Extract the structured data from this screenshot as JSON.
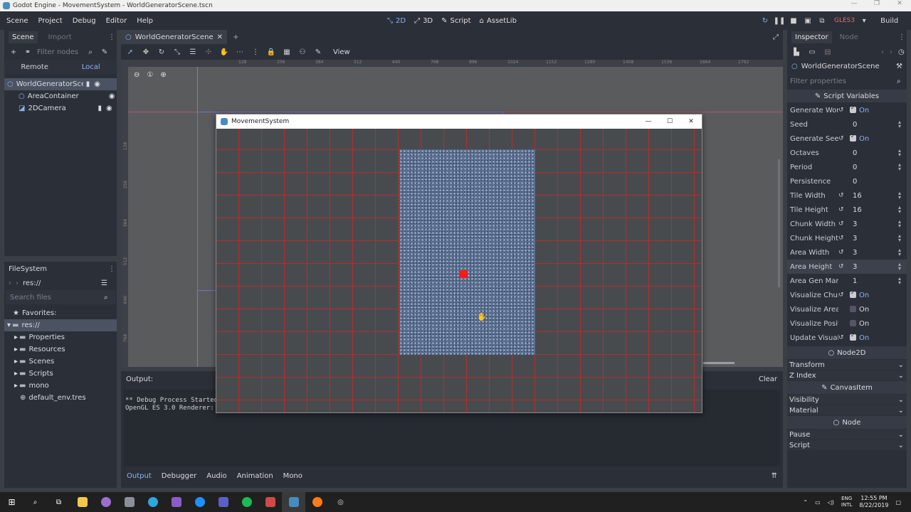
{
  "window": {
    "title": "Godot Engine - MovementSystem - WorldGeneratorScene.tscn"
  },
  "menu": [
    "Scene",
    "Project",
    "Debug",
    "Editor",
    "Help"
  ],
  "modes": {
    "d2": "2D",
    "d3": "3D",
    "script": "Script",
    "assetlib": "AssetLib"
  },
  "renderer": "GLES3",
  "build": "Build",
  "scene_dock": {
    "tabs": {
      "scene": "Scene",
      "import": "Import"
    },
    "filter_placeholder": "Filter nodes",
    "remote": "Remote",
    "local": "Local",
    "nodes": [
      {
        "label": "WorldGeneratorScen"
      },
      {
        "label": "AreaContainer"
      },
      {
        "label": "2DCamera"
      }
    ]
  },
  "filesystem": {
    "title": "FileSystem",
    "path": "res://",
    "search_placeholder": "Search files",
    "items": [
      {
        "label": "Favorites:"
      },
      {
        "label": "res://"
      },
      {
        "label": "Properties"
      },
      {
        "label": "Resources"
      },
      {
        "label": "Scenes"
      },
      {
        "label": "Scripts"
      },
      {
        "label": "mono"
      },
      {
        "label": "default_env.tres"
      }
    ]
  },
  "editor": {
    "tab": "WorldGeneratorScene",
    "view": "View",
    "ruler_labels": [
      "128",
      "256",
      "384",
      "512",
      "640",
      "768",
      "896",
      "1024",
      "1152",
      "1280",
      "1408",
      "1536",
      "1664",
      "1792"
    ],
    "vruler_labels": [
      "128",
      "256",
      "384",
      "512",
      "640",
      "768"
    ]
  },
  "game_window": {
    "title": "MovementSystem",
    "dot_color": "#ff1a1a",
    "grid_color": "#c82828"
  },
  "output": {
    "label": "Output:",
    "clear": "Clear",
    "lines": [
      "** Debug Process Started",
      "OpenGL ES 3.0 Renderer:"
    ],
    "tabs": [
      "Output",
      "Debugger",
      "Audio",
      "Animation",
      "Mono"
    ]
  },
  "inspector": {
    "tabs": {
      "inspector": "Inspector",
      "node": "Node"
    },
    "object": "WorldGeneratorScene",
    "filter_placeholder": "Filter properties",
    "section_script": "Script Variables",
    "props": [
      {
        "label": "Generate Worl",
        "value": "On",
        "kind": "check",
        "revert": true
      },
      {
        "label": "Seed",
        "value": "0",
        "kind": "num",
        "revert": false
      },
      {
        "label": "Generate Seed",
        "value": "On",
        "kind": "check",
        "revert": true
      },
      {
        "label": "Octaves",
        "value": "0",
        "kind": "num",
        "revert": false
      },
      {
        "label": "Period",
        "value": "0",
        "kind": "num",
        "revert": false
      },
      {
        "label": "Persistence",
        "value": "0",
        "kind": "plain",
        "revert": false
      },
      {
        "label": "Tile Width",
        "value": "16",
        "kind": "num",
        "revert": true
      },
      {
        "label": "Tile Height",
        "value": "16",
        "kind": "num",
        "revert": true
      },
      {
        "label": "Chunk Width",
        "value": "3",
        "kind": "num",
        "revert": true
      },
      {
        "label": "Chunk Height",
        "value": "3",
        "kind": "num",
        "revert": true
      },
      {
        "label": "Area Width",
        "value": "3",
        "kind": "num",
        "revert": true
      },
      {
        "label": "Area Height",
        "value": "3",
        "kind": "num",
        "revert": true
      },
      {
        "label": "Area Gen Margi",
        "value": "1",
        "kind": "num",
        "revert": false
      },
      {
        "label": "Visualize Chunk",
        "value": "On",
        "kind": "check",
        "revert": true
      },
      {
        "label": "Visualize Area Bo",
        "value": "On",
        "kind": "off",
        "revert": false
      },
      {
        "label": "Visualize Position",
        "value": "On",
        "kind": "off",
        "revert": false
      },
      {
        "label": "Update Visuals",
        "value": "On",
        "kind": "check",
        "revert": true
      }
    ],
    "node2d": "Node2D",
    "node2d_rows": [
      "Transform",
      "Z Index"
    ],
    "canvasitem": "CanvasItem",
    "canvas_rows": [
      "Visibility",
      "Material"
    ],
    "node": "Node",
    "node_rows": [
      "Pause",
      "Script"
    ]
  },
  "clock": {
    "time": "12:55 PM",
    "date": "8/22/2019",
    "lang": "ENG",
    "layout": "INTL"
  }
}
